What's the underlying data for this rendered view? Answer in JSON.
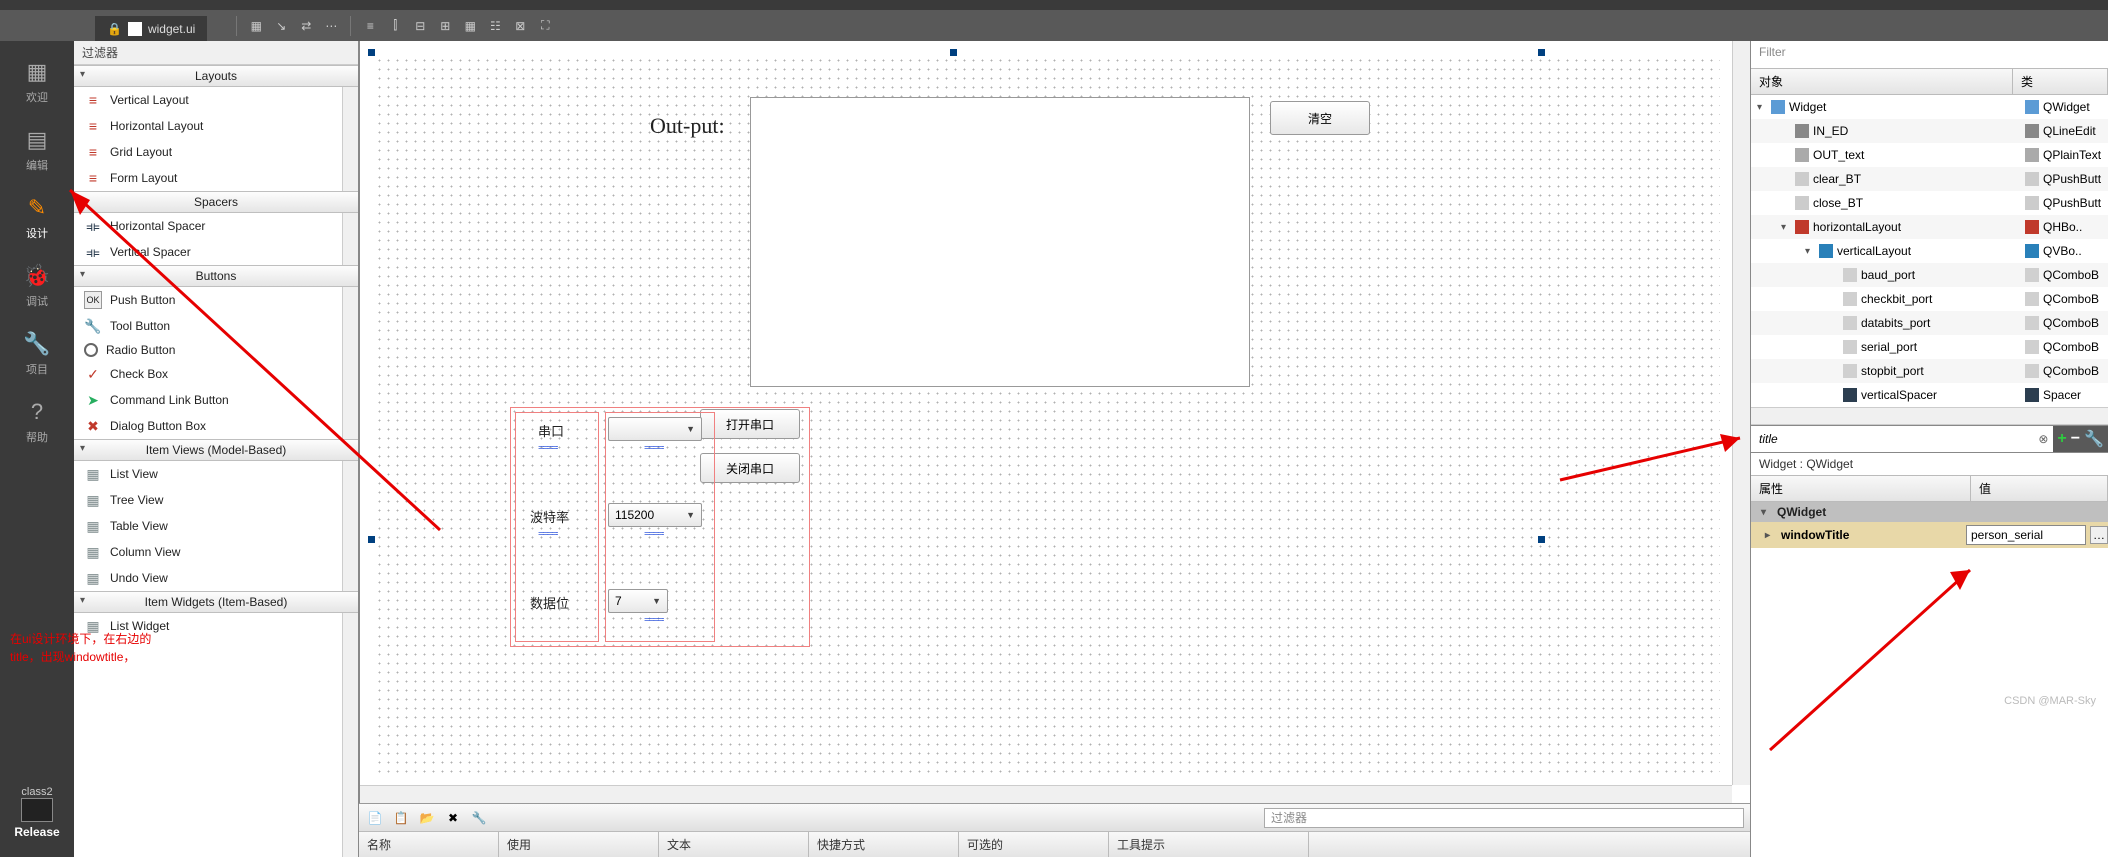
{
  "tab": {
    "filename": "widget.ui"
  },
  "leftbar": {
    "modes": [
      "欢迎",
      "编辑",
      "设计",
      "调试",
      "项目",
      "帮助"
    ],
    "kit_name": "class2",
    "kit_build": "Release"
  },
  "widgetbox": {
    "filter_label": "过滤器",
    "groups": [
      {
        "title": "Layouts",
        "items": [
          {
            "icon": "layout",
            "label": "Vertical Layout"
          },
          {
            "icon": "layout",
            "label": "Horizontal Layout"
          },
          {
            "icon": "layout",
            "label": "Grid Layout"
          },
          {
            "icon": "layout",
            "label": "Form Layout"
          }
        ]
      },
      {
        "title": "Spacers",
        "items": [
          {
            "icon": "spacer",
            "label": "Horizontal Spacer"
          },
          {
            "icon": "spacer",
            "label": "Vertical Spacer"
          }
        ]
      },
      {
        "title": "Buttons",
        "items": [
          {
            "icon": "ok",
            "label": "Push Button"
          },
          {
            "icon": "tool",
            "label": "Tool Button"
          },
          {
            "icon": "radio",
            "label": "Radio Button"
          },
          {
            "icon": "check",
            "label": "Check Box"
          },
          {
            "icon": "cmd",
            "label": "Command Link Button"
          },
          {
            "icon": "dlg",
            "label": "Dialog Button Box"
          }
        ]
      },
      {
        "title": "Item Views (Model-Based)",
        "items": [
          {
            "icon": "view",
            "label": "List View"
          },
          {
            "icon": "view",
            "label": "Tree View"
          },
          {
            "icon": "view",
            "label": "Table View"
          },
          {
            "icon": "view",
            "label": "Column View"
          },
          {
            "icon": "view",
            "label": "Undo View"
          }
        ]
      },
      {
        "title": "Item Widgets (Item-Based)",
        "items": [
          {
            "icon": "view",
            "label": "List Widget"
          }
        ]
      }
    ]
  },
  "canvas": {
    "out_label": "Out-put:",
    "clear_btn": "清空",
    "open_btn": "打开串口",
    "close_btn": "关闭串口",
    "labels": {
      "serial": "串口",
      "baud": "波特率",
      "databits": "数据位"
    },
    "combos": {
      "serial": "",
      "baud": "115200",
      "databits": "7"
    }
  },
  "actionpanel": {
    "filter_placeholder": "过滤器",
    "cols": [
      "名称",
      "使用",
      "文本",
      "快捷方式",
      "可选的",
      "工具提示"
    ]
  },
  "objtree": {
    "filter_placeholder": "Filter",
    "header": {
      "obj": "对象",
      "cls": "类"
    },
    "rows": [
      {
        "indent": 0,
        "tri": "▾",
        "name": "Widget",
        "cls": "QWidget",
        "icon": "oi-widget",
        "cicon": "oi-widget"
      },
      {
        "indent": 1,
        "tri": "",
        "name": "IN_ED",
        "cls": "QLineEdit",
        "icon": "oi-line",
        "cicon": "oi-line",
        "alt": true
      },
      {
        "indent": 1,
        "tri": "",
        "name": "OUT_text",
        "cls": "QPlainText",
        "icon": "oi-text",
        "cicon": "oi-text"
      },
      {
        "indent": 1,
        "tri": "",
        "name": "clear_BT",
        "cls": "QPushButt",
        "icon": "oi-btn",
        "cicon": "oi-btn",
        "alt": true
      },
      {
        "indent": 1,
        "tri": "",
        "name": "close_BT",
        "cls": "QPushButt",
        "icon": "oi-btn",
        "cicon": "oi-btn"
      },
      {
        "indent": 1,
        "tri": "▾",
        "name": "horizontalLayout",
        "cls": "QHBo..",
        "icon": "oi-hlay",
        "cicon": "oi-hlay",
        "alt": true
      },
      {
        "indent": 2,
        "tri": "▾",
        "name": "verticalLayout",
        "cls": "QVBo..",
        "icon": "oi-vlay",
        "cicon": "oi-vlay"
      },
      {
        "indent": 3,
        "tri": "",
        "name": "baud_port",
        "cls": "QComboB",
        "icon": "oi-combo",
        "cicon": "oi-combo",
        "alt": true
      },
      {
        "indent": 3,
        "tri": "",
        "name": "checkbit_port",
        "cls": "QComboB",
        "icon": "oi-combo",
        "cicon": "oi-combo"
      },
      {
        "indent": 3,
        "tri": "",
        "name": "databits_port",
        "cls": "QComboB",
        "icon": "oi-combo",
        "cicon": "oi-combo",
        "alt": true
      },
      {
        "indent": 3,
        "tri": "",
        "name": "serial_port",
        "cls": "QComboB",
        "icon": "oi-combo",
        "cicon": "oi-combo"
      },
      {
        "indent": 3,
        "tri": "",
        "name": "stopbit_port",
        "cls": "QComboB",
        "icon": "oi-combo",
        "cicon": "oi-combo",
        "alt": true
      },
      {
        "indent": 3,
        "tri": "",
        "name": "verticalSpacer",
        "cls": "Spacer",
        "icon": "oi-spacer",
        "cicon": "oi-spacer"
      }
    ]
  },
  "props": {
    "filter_value": "title",
    "context": "Widget : QWidget",
    "header": {
      "prop": "属性",
      "val": "值"
    },
    "group": "QWidget",
    "row": {
      "key": "windowTitle",
      "value": "person_serial"
    }
  },
  "annotation": {
    "line1": "在ui设计环境下，在右边的",
    "line2": "title，出现windowtitle，"
  },
  "watermark": "CSDN @MAR-Sky"
}
